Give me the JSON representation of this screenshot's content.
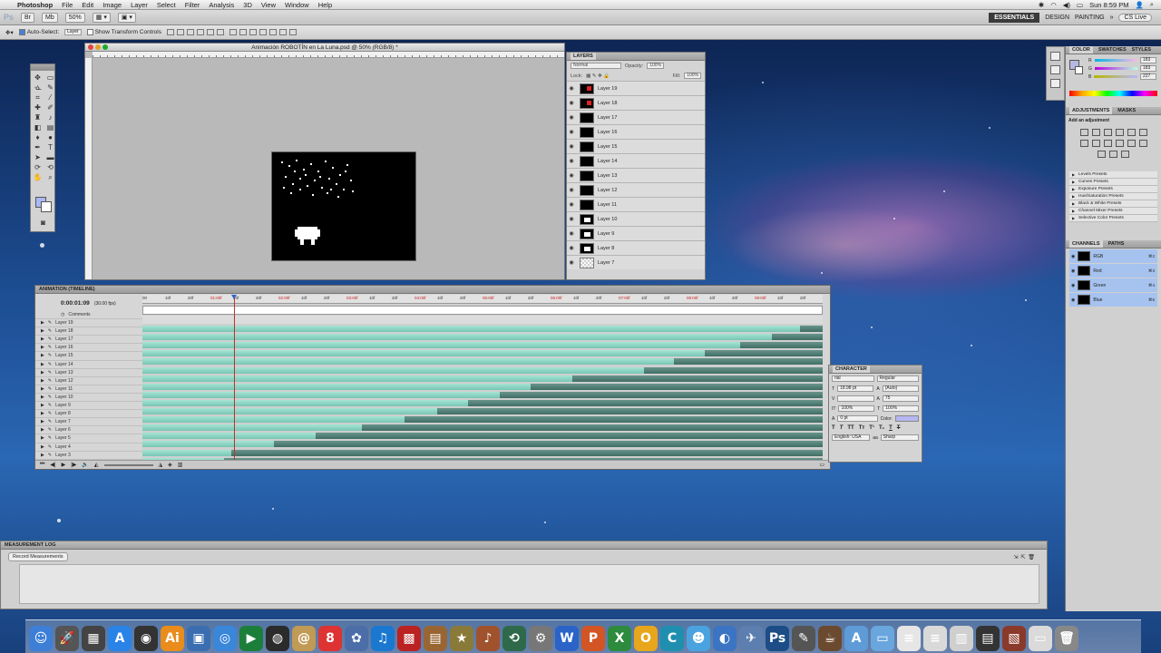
{
  "menubar": {
    "apple": "",
    "items": [
      "Photoshop",
      "File",
      "Edit",
      "Image",
      "Layer",
      "Select",
      "Filter",
      "Analysis",
      "3D",
      "View",
      "Window",
      "Help"
    ],
    "clock": "Sun 8:59 PM"
  },
  "appbar": {
    "logo": "Ps",
    "zoom": "50%",
    "workspaces": [
      "ESSENTIALS",
      "DESIGN",
      "PAINTING"
    ],
    "more": "»",
    "cslive": "CS Live"
  },
  "options": {
    "auto_select": "Auto-Select:",
    "auto_select_value": "Layer",
    "show_transform": "Show Transform Controls"
  },
  "document": {
    "title": "Animación ROBOTÍN en La Luna.psd @ 50% (RGB/8) *"
  },
  "layers_panel": {
    "title": "LAYERS",
    "blend": "Normal",
    "opacity_label": "Opacity:",
    "opacity": "100%",
    "lock_label": "Lock:",
    "fill_label": "Fill:",
    "fill": "100%",
    "layers": [
      {
        "name": "Layer 19",
        "thumb": "red"
      },
      {
        "name": "Layer 18",
        "thumb": "red"
      },
      {
        "name": "Layer 17",
        "thumb": "black"
      },
      {
        "name": "Layer 16",
        "thumb": "black"
      },
      {
        "name": "Layer 15",
        "thumb": "black"
      },
      {
        "name": "Layer 14",
        "thumb": "black"
      },
      {
        "name": "Layer 13",
        "thumb": "black"
      },
      {
        "name": "Layer 12",
        "thumb": "black"
      },
      {
        "name": "Layer 11",
        "thumb": "black"
      },
      {
        "name": "Layer 10",
        "thumb": "robo"
      },
      {
        "name": "Layer 9",
        "thumb": "robo"
      },
      {
        "name": "Layer 8",
        "thumb": "robo"
      },
      {
        "name": "Layer 7",
        "thumb": "trans"
      }
    ]
  },
  "timeline": {
    "title": "ANIMATION (TIMELINE)",
    "timecode": "0:00:01:09",
    "fps": "(30.00 fps)",
    "comments_label": "Comments",
    "ruler": [
      "00",
      "10f",
      "20f",
      "01:00f",
      "10f",
      "20f",
      "02:00f",
      "10f",
      "20f",
      "03:00f",
      "10f",
      "20f",
      "04:00f",
      "10f",
      "20f",
      "05:00f",
      "10f",
      "20f",
      "06:00f",
      "10f",
      "20f",
      "07:00f",
      "10f",
      "20f",
      "08:00f",
      "10f",
      "20f",
      "09:00f",
      "10f",
      "20f"
    ],
    "tracks": [
      {
        "name": "Layer 19",
        "start": 0.967
      },
      {
        "name": "Layer 18",
        "start": 0.925
      },
      {
        "name": "Layer 17",
        "start": 0.878
      },
      {
        "name": "Layer 16",
        "start": 0.827
      },
      {
        "name": "Layer 15",
        "start": 0.781
      },
      {
        "name": "Layer 14",
        "start": 0.737
      },
      {
        "name": "Layer 13",
        "start": 0.632
      },
      {
        "name": "Layer 12",
        "start": 0.57
      },
      {
        "name": "Layer 11",
        "start": 0.525
      },
      {
        "name": "Layer 10",
        "start": 0.478
      },
      {
        "name": "Layer 9",
        "start": 0.433
      },
      {
        "name": "Layer 8",
        "start": 0.386
      },
      {
        "name": "Layer 7",
        "start": 0.323
      },
      {
        "name": "Layer 6",
        "start": 0.255
      },
      {
        "name": "Layer 5",
        "start": 0.193
      },
      {
        "name": "Layer 4",
        "start": 0.13
      },
      {
        "name": "Layer 3",
        "start": 0.12
      }
    ],
    "playhead_fraction": 0.134
  },
  "character": {
    "title": "CHARACTER",
    "font": "rial",
    "style": "Regular",
    "size": "18.98 pt",
    "leading": "(Auto)",
    "tracking": "75",
    "scale_v": "100%",
    "scale_h": "100%",
    "baseline": "0 pt",
    "color_label": "Color:",
    "language": "English: USA",
    "aa": "Sharp"
  },
  "color_panel": {
    "tabs": [
      "COLOR",
      "SWATCHES",
      "STYLES"
    ],
    "r": "183",
    "g": "183",
    "b": "227"
  },
  "adjustments": {
    "tabs": [
      "ADJUSTMENTS",
      "MASKS"
    ],
    "hint": "Add an adjustment",
    "presets": [
      "Levels Presets",
      "Curves Presets",
      "Exposure Presets",
      "Hue/Saturation Presets",
      "Black & White Presets",
      "Channel Mixer Presets",
      "Selective Color Presets"
    ]
  },
  "channels": {
    "tabs": [
      "CHANNELS",
      "PATHS"
    ],
    "rows": [
      {
        "name": "RGB",
        "key": "⌘2"
      },
      {
        "name": "Red",
        "key": "⌘3"
      },
      {
        "name": "Green",
        "key": "⌘4"
      },
      {
        "name": "Blue",
        "key": "⌘5"
      }
    ]
  },
  "measurement": {
    "title": "MEASUREMENT LOG",
    "record": "Record Measurements"
  },
  "dock": [
    {
      "name": "finder",
      "glyph": "☺",
      "color": "#3d7fd6"
    },
    {
      "name": "launchpad",
      "glyph": "🚀",
      "color": "#555"
    },
    {
      "name": "mission-control",
      "glyph": "▦",
      "color": "#444"
    },
    {
      "name": "app-store",
      "glyph": "A",
      "color": "#2a83e6"
    },
    {
      "name": "dashboard",
      "glyph": "◉",
      "color": "#333"
    },
    {
      "name": "illustrator",
      "glyph": "Ai",
      "color": "#e98c1c"
    },
    {
      "name": "preview",
      "glyph": "▣",
      "color": "#3a6eb0"
    },
    {
      "name": "safari",
      "glyph": "◎",
      "color": "#3a86d9"
    },
    {
      "name": "facetime",
      "glyph": "▶",
      "color": "#1b7f3a"
    },
    {
      "name": "photo-booth",
      "glyph": "◍",
      "color": "#2b2b2b"
    },
    {
      "name": "address-book",
      "glyph": "@",
      "color": "#c19a55"
    },
    {
      "name": "ical",
      "glyph": "8",
      "color": "#d33"
    },
    {
      "name": "iphoto",
      "glyph": "✿",
      "color": "#4b6ea8"
    },
    {
      "name": "itunes",
      "glyph": "♫",
      "color": "#1b78d0"
    },
    {
      "name": "photo-app",
      "glyph": "▩",
      "color": "#b22"
    },
    {
      "name": "image-capture",
      "glyph": "▤",
      "color": "#996633"
    },
    {
      "name": "star-app",
      "glyph": "★",
      "color": "#8a7a3a"
    },
    {
      "name": "garageband",
      "glyph": "♪",
      "color": "#a0522d"
    },
    {
      "name": "time-machine",
      "glyph": "⟲",
      "color": "#2e6a4a"
    },
    {
      "name": "settings",
      "glyph": "⚙",
      "color": "#777"
    },
    {
      "name": "word",
      "glyph": "W",
      "color": "#2b63c8"
    },
    {
      "name": "powerpoint",
      "glyph": "P",
      "color": "#d35424"
    },
    {
      "name": "excel",
      "glyph": "X",
      "color": "#2c8b3c"
    },
    {
      "name": "outlook",
      "glyph": "O",
      "color": "#e8a61c"
    },
    {
      "name": "communicator",
      "glyph": "C",
      "color": "#1f8fb0"
    },
    {
      "name": "messenger",
      "glyph": "☻",
      "color": "#4aa3df"
    },
    {
      "name": "network",
      "glyph": "◐",
      "color": "#3b74c2"
    },
    {
      "name": "xcode",
      "glyph": "✈",
      "color": "#5c7fb0"
    },
    {
      "name": "photoshop",
      "glyph": "Ps",
      "color": "#1c4d86"
    },
    {
      "name": "utility",
      "glyph": "✎",
      "color": "#555"
    },
    {
      "name": "coffee",
      "glyph": "☕",
      "color": "#6b4a2f"
    },
    {
      "name": "applications-folder",
      "glyph": "A",
      "color": "#5f9bd6"
    },
    {
      "name": "documents-folder",
      "glyph": "▭",
      "color": "#6aa6de"
    },
    {
      "name": "doc-1",
      "glyph": "≡",
      "color": "#e6e6e6"
    },
    {
      "name": "doc-2",
      "glyph": "≡",
      "color": "#d9d9d9"
    },
    {
      "name": "doc-3",
      "glyph": "▥",
      "color": "#cfcfcf"
    },
    {
      "name": "doc-4",
      "glyph": "▤",
      "color": "#333"
    },
    {
      "name": "doc-5",
      "glyph": "▧",
      "color": "#8a3a2a"
    },
    {
      "name": "doc-6",
      "glyph": "▭",
      "color": "#dadada"
    },
    {
      "name": "trash",
      "glyph": "🗑",
      "color": "#888"
    }
  ]
}
